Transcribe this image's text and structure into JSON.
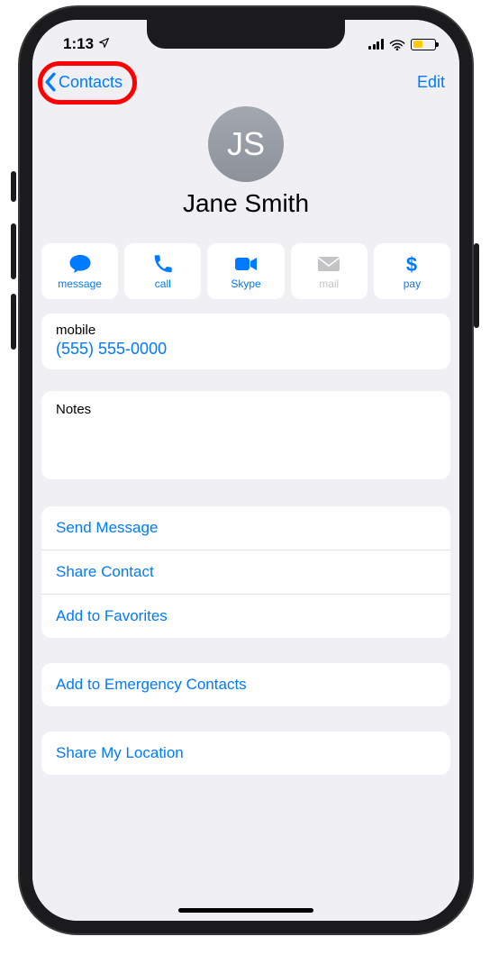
{
  "status_bar": {
    "time": "1:13"
  },
  "nav": {
    "back_label": "Contacts",
    "edit_label": "Edit"
  },
  "contact": {
    "initials": "JS",
    "name": "Jane Smith"
  },
  "actions": {
    "message": "message",
    "call": "call",
    "video": "Skype",
    "mail": "mail",
    "pay": "pay"
  },
  "fields": {
    "mobile_label": "mobile",
    "mobile_value": "(555) 555-0000",
    "notes_label": "Notes"
  },
  "links": {
    "send_message": "Send Message",
    "share_contact": "Share Contact",
    "add_favorites": "Add to Favorites",
    "add_emergency": "Add to Emergency Contacts",
    "share_location": "Share My Location"
  }
}
